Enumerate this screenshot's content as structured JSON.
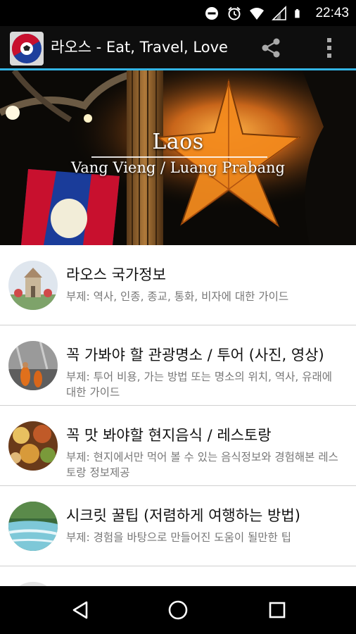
{
  "status_bar": {
    "time": "22:43",
    "icons": [
      "do-not-disturb-icon",
      "alarm-icon",
      "wifi-icon",
      "signal-icon",
      "battery-icon"
    ]
  },
  "app_bar": {
    "title": "라오스 - Eat, Travel, Love",
    "logo_icon": "laos-app-logo",
    "actions": [
      "share-icon",
      "overflow-menu-icon"
    ],
    "accent_color": "#33b5e5"
  },
  "banner": {
    "title": "Laos",
    "subtitle": "Vang Vieng / Luang Prabang"
  },
  "list": {
    "items": [
      {
        "title": "라오스 국가정보",
        "subtitle": "부제: 역사, 인종, 종교, 통화, 비자에 대한 가이드",
        "thumbnail": "monument-thumbnail"
      },
      {
        "title": "꼭 가봐야 할 관광명소 / 투어 (사진, 영상)",
        "subtitle": "부제: 투어 비용, 가는 방법 또는 명소의 위치, 역사, 유래에 대한 가이드",
        "thumbnail": "monks-thumbnail"
      },
      {
        "title": "꼭 맛 봐야할 현지음식 / 레스토랑",
        "subtitle": "부제: 현지에서만 먹어 볼 수 있는 음식정보와 경험해본 레스토랑 정보제공",
        "thumbnail": "food-thumbnail"
      },
      {
        "title": "시크릿 꿀팁  (저렴하게 여행하는 방법)",
        "subtitle": "부제: 경험을 바탕으로 만들어진 도움이 될만한 팁",
        "thumbnail": "waterfall-thumbnail"
      }
    ]
  },
  "nav_bar": {
    "buttons": [
      "back-icon",
      "home-icon",
      "recents-icon"
    ]
  }
}
